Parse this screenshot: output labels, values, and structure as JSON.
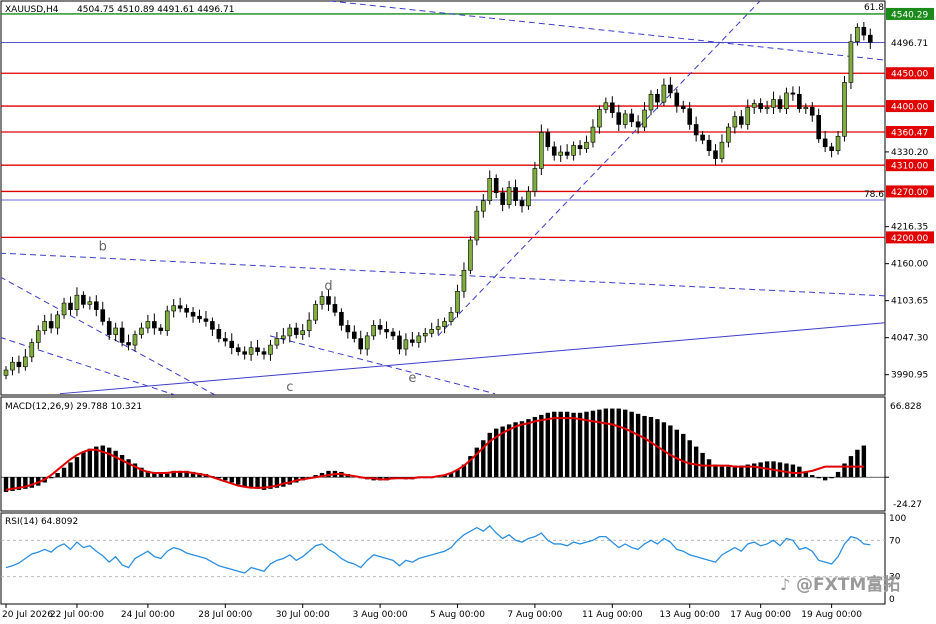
{
  "header": {
    "symbol": "XAUUSD,H4",
    "ohlc": "4504.75 4510.89 4491.61 4496.71"
  },
  "colors": {
    "bull": "#7fae3c",
    "bear": "#000000",
    "support": "#e00000",
    "trend": "#3d3dc9",
    "fib": "#1a8a1a",
    "macd_signal": "#e00000",
    "rsi": "#2b8fe0",
    "price_tag": "#e00000",
    "current_tag": "#000000"
  },
  "chart_data": [
    {
      "type": "candlestick",
      "symbol": "XAUUSD",
      "timeframe": "H4",
      "ylim": [
        3960,
        4560
      ],
      "y_ticks": [
        3990.95,
        4047.3,
        4103.65,
        4160.0,
        4216.35,
        4330.2
      ],
      "x_ticks": [
        "20 Jul 2026",
        "22 Jul 00:00",
        "24 Jul 00:00",
        "28 Jul 00:00",
        "30 Jul 00:00",
        "3 Aug 00:00",
        "5 Aug 00:00",
        "7 Aug 00:00",
        "11 Aug 00:00",
        "13 Aug 00:00",
        "17 Aug 00:00",
        "19 Aug 00:00"
      ],
      "current_price": "4496.71",
      "levels": [
        {
          "label": "4540.29",
          "value": 4540.29,
          "style": "fib"
        },
        {
          "label": "4450.00",
          "value": 4450.0,
          "style": "support"
        },
        {
          "label": "4400.00",
          "value": 4400.0,
          "style": "support"
        },
        {
          "label": "4360.47",
          "value": 4360.47,
          "style": "support"
        },
        {
          "label": "4310.00",
          "value": 4310.0,
          "style": "support"
        },
        {
          "label": "4270.00",
          "value": 4270.0,
          "style": "support"
        },
        {
          "label": "4200.00",
          "value": 4200.0,
          "style": "support"
        }
      ],
      "fib_labels": [
        "61.8",
        "78.6"
      ],
      "wave_labels": [
        "b",
        "c",
        "d",
        "e"
      ],
      "close": [
        3998,
        4010,
        4003,
        4018,
        4040,
        4058,
        4072,
        4062,
        4082,
        4100,
        4090,
        4112,
        4098,
        4102,
        4090,
        4072,
        4052,
        4062,
        4040,
        4036,
        4052,
        4062,
        4072,
        4062,
        4058,
        4088,
        4096,
        4092,
        4086,
        4080,
        4076,
        4072,
        4060,
        4046,
        4042,
        4032,
        4026,
        4022,
        4032,
        4026,
        4022,
        4036,
        4046,
        4050,
        4062,
        4052,
        4058,
        4074,
        4098,
        4110,
        4098,
        4086,
        4066,
        4056,
        4046,
        4030,
        4050,
        4066,
        4060,
        4056,
        4050,
        4030,
        4044,
        4040,
        4050,
        4054,
        4060,
        4064,
        4072,
        4086,
        4118,
        4150,
        4196,
        4240,
        4256,
        4290,
        4268,
        4250,
        4276,
        4256,
        4248,
        4270,
        4305,
        4360,
        4338,
        4325,
        4330,
        4325,
        4340,
        4335,
        4345,
        4368,
        4395,
        4405,
        4390,
        4372,
        4388,
        4376,
        4368,
        4394,
        4418,
        4406,
        4432,
        4420,
        4400,
        4396,
        4372,
        4356,
        4348,
        4332,
        4320,
        4345,
        4368,
        4384,
        4372,
        4398,
        4404,
        4396,
        4398,
        4410,
        4396,
        4420,
        4418,
        4396,
        4398,
        4386,
        4350,
        4338,
        4332,
        4354,
        4436,
        4498,
        4520,
        4508,
        4497
      ],
      "open": [
        3990,
        3998,
        4010,
        4003,
        4018,
        4040,
        4058,
        4072,
        4062,
        4082,
        4100,
        4090,
        4112,
        4098,
        4102,
        4090,
        4072,
        4052,
        4062,
        4040,
        4036,
        4052,
        4062,
        4072,
        4062,
        4058,
        4088,
        4096,
        4092,
        4086,
        4080,
        4076,
        4072,
        4060,
        4046,
        4042,
        4032,
        4026,
        4022,
        4032,
        4026,
        4022,
        4036,
        4046,
        4050,
        4062,
        4052,
        4058,
        4074,
        4098,
        4110,
        4098,
        4086,
        4066,
        4056,
        4046,
        4030,
        4050,
        4066,
        4060,
        4056,
        4050,
        4030,
        4044,
        4040,
        4050,
        4054,
        4060,
        4064,
        4072,
        4086,
        4118,
        4150,
        4196,
        4240,
        4256,
        4290,
        4268,
        4250,
        4276,
        4256,
        4248,
        4270,
        4305,
        4360,
        4338,
        4325,
        4330,
        4325,
        4340,
        4335,
        4345,
        4368,
        4395,
        4405,
        4390,
        4372,
        4388,
        4376,
        4368,
        4394,
        4418,
        4406,
        4432,
        4420,
        4400,
        4396,
        4372,
        4356,
        4348,
        4332,
        4320,
        4345,
        4368,
        4384,
        4372,
        4398,
        4404,
        4396,
        4398,
        4410,
        4396,
        4420,
        4418,
        4396,
        4398,
        4386,
        4350,
        4338,
        4332,
        4354,
        4436,
        4498,
        4520,
        4508
      ]
    },
    {
      "type": "bar",
      "indicator": "MACD",
      "header": "MACD(12,26,9) 29.788 10.321",
      "ylim": [
        -32,
        75
      ],
      "y_ticks": [
        "66.828",
        "-24.27"
      ],
      "histogram": [
        -14,
        -13,
        -12,
        -11,
        -10,
        -8,
        -5,
        -1,
        4,
        9,
        14,
        19,
        24,
        27,
        29,
        30,
        28,
        25,
        21,
        17,
        13,
        9,
        6,
        4,
        4,
        5,
        6,
        6,
        6,
        5,
        4,
        3,
        1,
        -1,
        -3,
        -5,
        -7,
        -9,
        -10,
        -11,
        -12,
        -11,
        -10,
        -9,
        -7,
        -5,
        -3,
        -1,
        2,
        4,
        6,
        6,
        5,
        3,
        1,
        -1,
        -2,
        -3,
        -3,
        -3,
        -2,
        -1,
        -2,
        -2,
        -1,
        0,
        0,
        1,
        2,
        4,
        7,
        12,
        20,
        28,
        35,
        42,
        46,
        48,
        50,
        52,
        53,
        55,
        57,
        59,
        61,
        62,
        62,
        62,
        61,
        61,
        62,
        63,
        64,
        65,
        65,
        65,
        64,
        62,
        60,
        58,
        57,
        55,
        52,
        49,
        45,
        41,
        35,
        29,
        23,
        17,
        12,
        10,
        10,
        11,
        11,
        12,
        13,
        14,
        15,
        15,
        14,
        13,
        12,
        10,
        5,
        2,
        -1,
        -3,
        -1,
        5,
        13,
        20,
        26,
        30
      ],
      "signal": [
        -12,
        -11,
        -10,
        -9,
        -7,
        -5,
        -2,
        2,
        7,
        12,
        17,
        21,
        24,
        26,
        26,
        24,
        22,
        19,
        16,
        13,
        10,
        7,
        5,
        4,
        4,
        4,
        5,
        5,
        5,
        4,
        3,
        2,
        0,
        -2,
        -4,
        -6,
        -8,
        -9,
        -10,
        -10,
        -10,
        -9,
        -8,
        -6,
        -5,
        -3,
        -2,
        -1,
        0,
        1,
        2,
        3,
        3,
        2,
        1,
        0,
        -1,
        -1,
        -2,
        -2,
        -1,
        -1,
        -1,
        -1,
        0,
        0,
        0,
        1,
        2,
        4,
        7,
        11,
        16,
        22,
        28,
        34,
        38,
        42,
        45,
        48,
        50,
        51,
        53,
        54,
        55,
        56,
        56,
        56,
        56,
        55,
        54,
        53,
        52,
        51,
        50,
        48,
        46,
        43,
        40,
        37,
        33,
        29,
        25,
        21,
        18,
        15,
        13,
        12,
        11,
        11,
        11,
        11,
        11,
        10,
        10,
        10,
        10,
        9,
        8,
        7,
        6,
        5,
        4,
        4,
        5,
        6,
        8,
        10,
        10,
        10,
        10,
        10,
        10,
        10
      ]
    },
    {
      "type": "line",
      "indicator": "RSI",
      "header": "RSI(14) 64.8092",
      "ylim": [
        0,
        100
      ],
      "y_ticks": [
        "100",
        "70",
        "30",
        "0"
      ],
      "values": [
        40,
        42,
        45,
        50,
        55,
        57,
        60,
        57,
        63,
        66,
        60,
        68,
        62,
        64,
        58,
        53,
        46,
        52,
        43,
        40,
        50,
        54,
        58,
        52,
        50,
        58,
        62,
        60,
        56,
        54,
        52,
        50,
        46,
        42,
        40,
        38,
        36,
        34,
        40,
        38,
        36,
        44,
        48,
        50,
        54,
        48,
        52,
        58,
        64,
        66,
        60,
        56,
        50,
        46,
        44,
        40,
        48,
        54,
        52,
        50,
        48,
        42,
        48,
        46,
        50,
        52,
        54,
        56,
        58,
        62,
        70,
        76,
        80,
        84,
        80,
        86,
        78,
        72,
        76,
        70,
        68,
        72,
        74,
        78,
        70,
        66,
        66,
        64,
        68,
        66,
        68,
        70,
        74,
        74,
        68,
        62,
        66,
        62,
        60,
        66,
        70,
        66,
        72,
        68,
        60,
        58,
        54,
        52,
        50,
        48,
        46,
        54,
        58,
        62,
        58,
        66,
        68,
        64,
        66,
        70,
        64,
        72,
        70,
        60,
        62,
        58,
        48,
        46,
        44,
        52,
        66,
        74,
        72,
        66,
        65
      ]
    }
  ],
  "watermark": "@FXTM富拓"
}
